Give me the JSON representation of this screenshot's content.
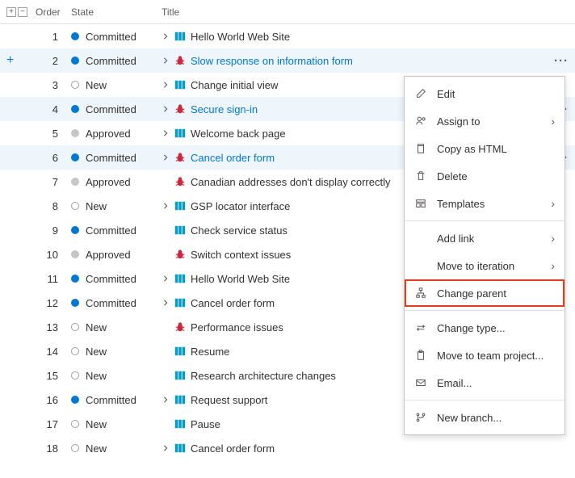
{
  "headers": {
    "order": "Order",
    "state": "State",
    "title": "Title"
  },
  "state_labels": {
    "committed": "Committed",
    "new": "New",
    "approved": "Approved"
  },
  "rows": [
    {
      "order": 1,
      "state": "committed",
      "expandable": true,
      "type": "pbi",
      "title": "Hello World Web Site",
      "selected": false,
      "actions": false,
      "link": false
    },
    {
      "order": 2,
      "state": "committed",
      "expandable": true,
      "type": "bug",
      "title": "Slow response on information form",
      "selected": true,
      "actions": true,
      "link": true,
      "add": true
    },
    {
      "order": 3,
      "state": "new",
      "expandable": true,
      "type": "pbi",
      "title": "Change initial view",
      "selected": false,
      "actions": false,
      "link": false
    },
    {
      "order": 4,
      "state": "committed",
      "expandable": true,
      "type": "bug",
      "title": "Secure sign-in",
      "selected": true,
      "actions": true,
      "link": true
    },
    {
      "order": 5,
      "state": "approved",
      "expandable": true,
      "type": "pbi",
      "title": "Welcome back page",
      "selected": false,
      "actions": false,
      "link": false
    },
    {
      "order": 6,
      "state": "committed",
      "expandable": true,
      "type": "bug",
      "title": "Cancel order form",
      "selected": true,
      "actions": true,
      "link": true
    },
    {
      "order": 7,
      "state": "approved",
      "expandable": false,
      "type": "bug",
      "title": "Canadian addresses don't display correctly",
      "selected": false,
      "actions": false,
      "link": false
    },
    {
      "order": 8,
      "state": "new",
      "expandable": true,
      "type": "pbi",
      "title": "GSP locator interface",
      "selected": false,
      "actions": false,
      "link": false
    },
    {
      "order": 9,
      "state": "committed",
      "expandable": false,
      "type": "pbi",
      "title": "Check service status",
      "selected": false,
      "actions": false,
      "link": false
    },
    {
      "order": 10,
      "state": "approved",
      "expandable": false,
      "type": "bug",
      "title": "Switch context issues",
      "selected": false,
      "actions": false,
      "link": false
    },
    {
      "order": 11,
      "state": "committed",
      "expandable": true,
      "type": "pbi",
      "title": "Hello World Web Site",
      "selected": false,
      "actions": false,
      "link": false
    },
    {
      "order": 12,
      "state": "committed",
      "expandable": true,
      "type": "pbi",
      "title": "Cancel order form",
      "selected": false,
      "actions": false,
      "link": false
    },
    {
      "order": 13,
      "state": "new",
      "expandable": false,
      "type": "bug",
      "title": "Performance issues",
      "selected": false,
      "actions": false,
      "link": false
    },
    {
      "order": 14,
      "state": "new",
      "expandable": false,
      "type": "pbi",
      "title": "Resume",
      "selected": false,
      "actions": false,
      "link": false
    },
    {
      "order": 15,
      "state": "new",
      "expandable": false,
      "type": "pbi",
      "title": "Research architecture changes",
      "selected": false,
      "actions": false,
      "link": false
    },
    {
      "order": 16,
      "state": "committed",
      "expandable": true,
      "type": "pbi",
      "title": "Request support",
      "selected": false,
      "actions": false,
      "link": false
    },
    {
      "order": 17,
      "state": "new",
      "expandable": false,
      "type": "pbi",
      "title": "Pause",
      "selected": false,
      "actions": false,
      "link": false
    },
    {
      "order": 18,
      "state": "new",
      "expandable": true,
      "type": "pbi",
      "title": "Cancel order form",
      "selected": false,
      "actions": false,
      "link": false
    }
  ],
  "menu": {
    "edit": "Edit",
    "assign_to": "Assign to",
    "copy_html": "Copy as HTML",
    "delete": "Delete",
    "templates": "Templates",
    "add_link": "Add link",
    "move_iteration": "Move to iteration",
    "change_parent": "Change parent",
    "change_type": "Change type...",
    "move_team_project": "Move to team project...",
    "email": "Email...",
    "new_branch": "New branch..."
  }
}
